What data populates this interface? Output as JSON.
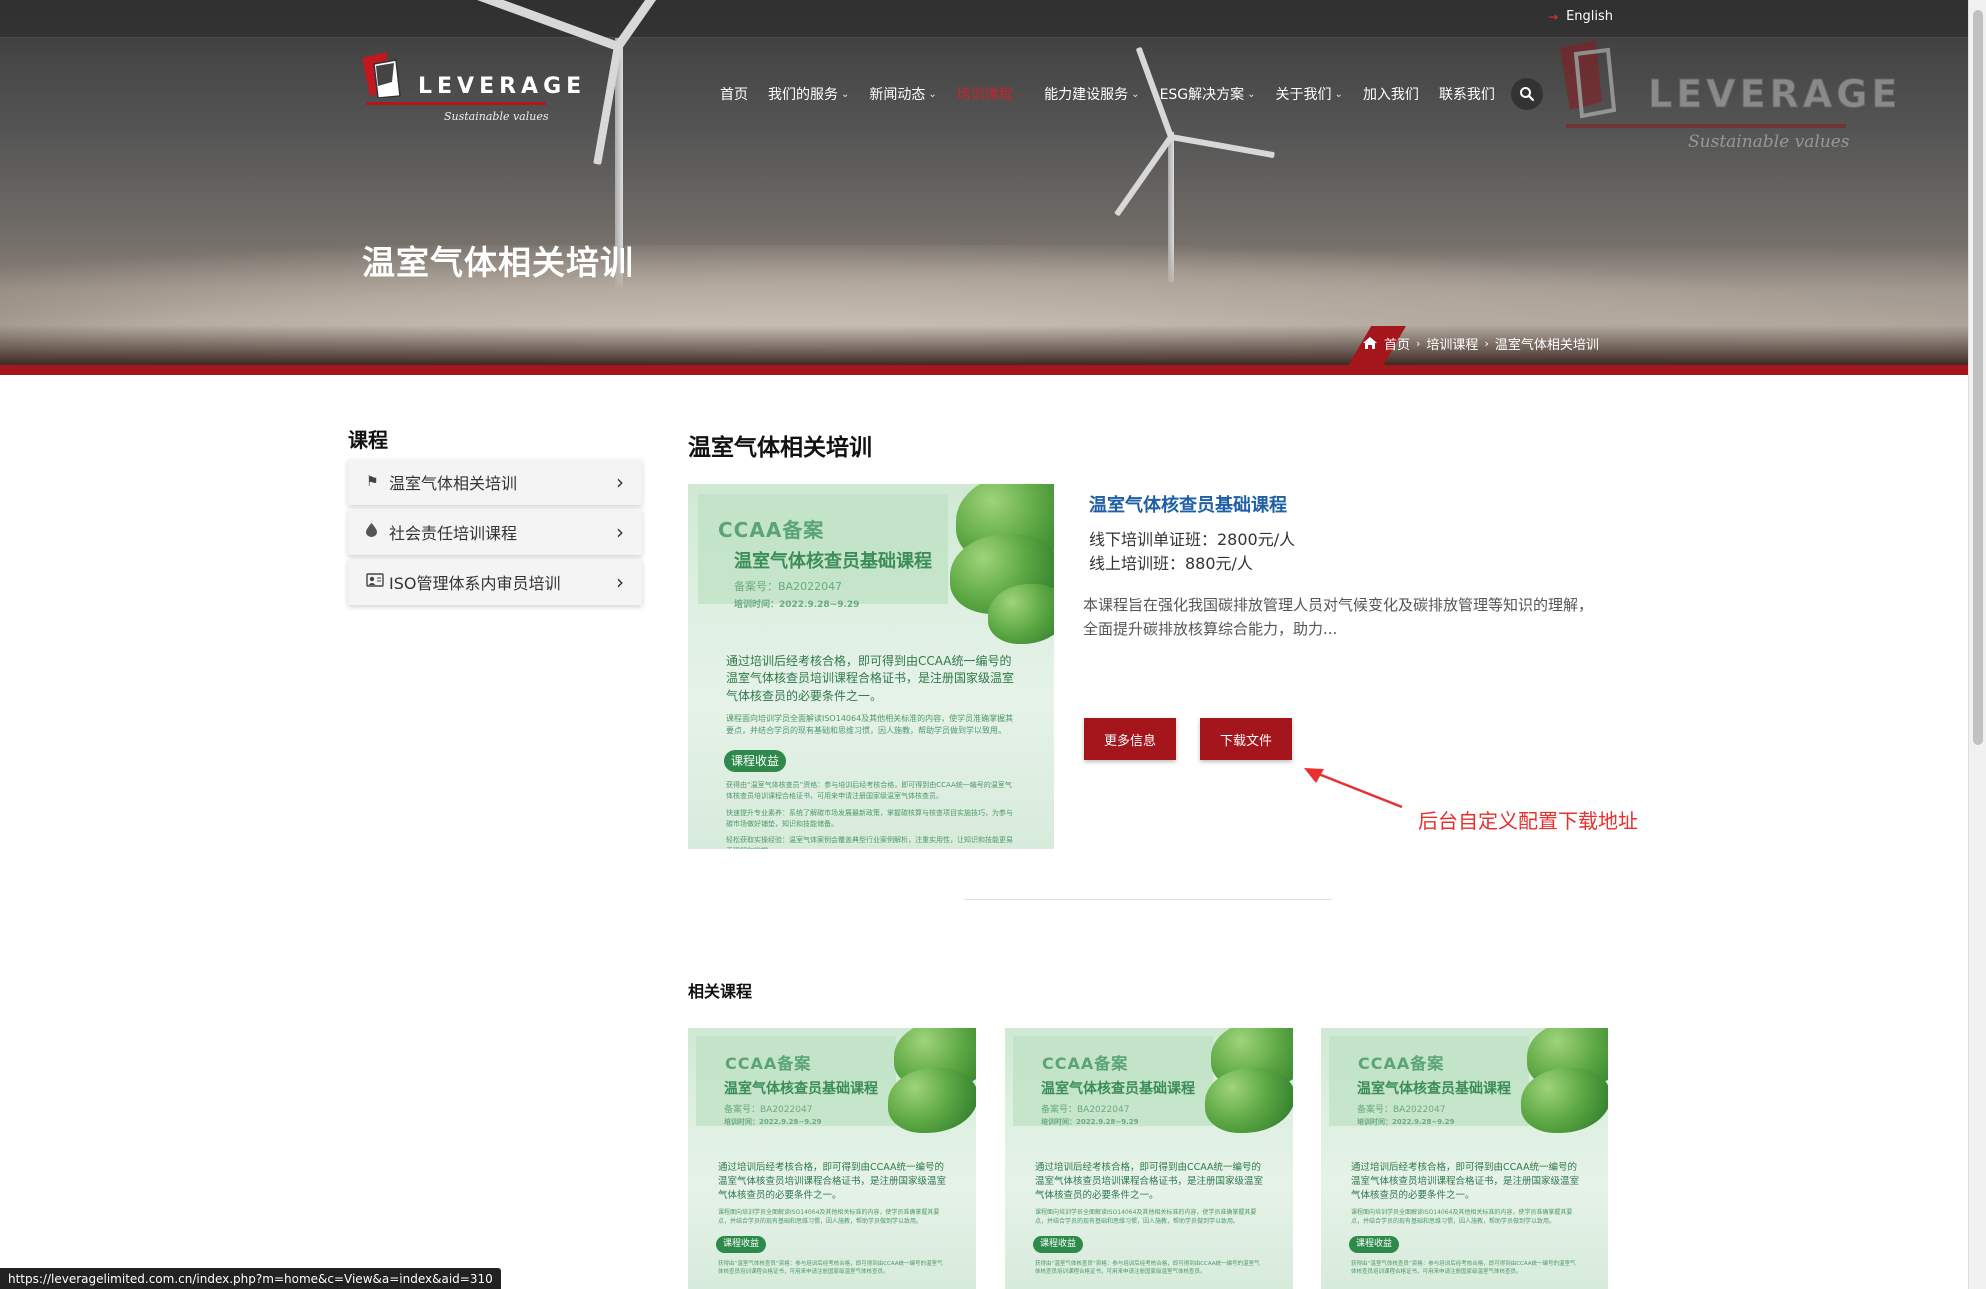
{
  "header": {
    "language": "English",
    "logo": {
      "word": "LEVERAGE",
      "tagline": "Sustainable values"
    },
    "nav": [
      {
        "label": "首页",
        "has_dropdown": false,
        "active": false
      },
      {
        "label": "我们的服务",
        "has_dropdown": true,
        "active": false
      },
      {
        "label": "新闻动态",
        "has_dropdown": true,
        "active": false
      },
      {
        "label": "培训课程",
        "has_dropdown": true,
        "active": true
      },
      {
        "label": "能力建设服务",
        "has_dropdown": true,
        "active": false
      },
      {
        "label": "ESG解决方案",
        "has_dropdown": true,
        "active": false
      },
      {
        "label": "关于我们",
        "has_dropdown": true,
        "active": false
      },
      {
        "label": "加入我们",
        "has_dropdown": false,
        "active": false
      },
      {
        "label": "联系我们",
        "has_dropdown": false,
        "active": false
      }
    ],
    "search_icon": "search-icon"
  },
  "hero": {
    "title": "温室气体相关培训",
    "breadcrumb": [
      "首页",
      "培训课程",
      "温室气体相关培训"
    ]
  },
  "sidebar": {
    "title": "课程",
    "items": [
      {
        "icon": "flag-icon",
        "glyph": "⚑",
        "label": "温室气体相关培训"
      },
      {
        "icon": "drop-icon",
        "glyph": "💧",
        "label": "社会责任培训课程"
      },
      {
        "icon": "id-card-icon",
        "glyph": "🪪",
        "label": "ISO管理体系内审员培训"
      }
    ]
  },
  "main": {
    "title": "温室气体相关培训",
    "course": {
      "title": "温室气体核查员基础课程",
      "price_offline": "线下培训单证班：2800元/人",
      "price_online": "线上培训班：880元/人",
      "description": "本课程旨在强化我国碳排放管理人员对气候变化及碳排放管理等知识的理解，全面提升碳排放核算综合能力，助力...",
      "more_button": "更多信息",
      "download_button": "下载文件"
    },
    "annotation": "后台自定义配置下载地址",
    "related_title": "相关课程"
  },
  "poster": {
    "badge": "CCAA备案",
    "title": "温室气体核查员基础课程",
    "record_no": "备案号：BA2022047",
    "dates": "培训时间：2022.9.28~9.29",
    "body": "通过培训后经考核合格，即可得到由CCAA统一编号的温室气体核查员培训课程合格证书，是注册国家级温室气体核查员的必要条件之一。",
    "small": "课程面向培训学员全面解读ISO14064及其他相关标准的内容，使学员准确掌握其要点，并结合学员的现有基础和思维习惯，因人施教，帮助学员做到学以致用。",
    "pill": "课程收益",
    "bullets": [
      "获得由“温室气体核查员”资格：参与培训后经考核合格，即可得到由CCAA统一编号的温室气体核查员培训课程合格证书，可用来申请注册国家级温室气体核查员。",
      "快速提升专业素养：系统了解碳市场发展最新政策，掌握碳核算与核查项目实施技巧，为参与碳市场做好铺垫，知识和技能储备。",
      "轻松获取实操经验：温室气体案例会覆盖典型行业案例解析，注重实用性，让知识和技能更易于理解和掌握。"
    ]
  },
  "status_url": "https://leveragelimited.com.cn/index.php?m=home&c=View&a=index&aid=310",
  "colors": {
    "brand_red": "#a4161b",
    "link_blue": "#1e5fa6",
    "annotation_red": "#e8302e",
    "poster_green": "#3d8d5b"
  }
}
